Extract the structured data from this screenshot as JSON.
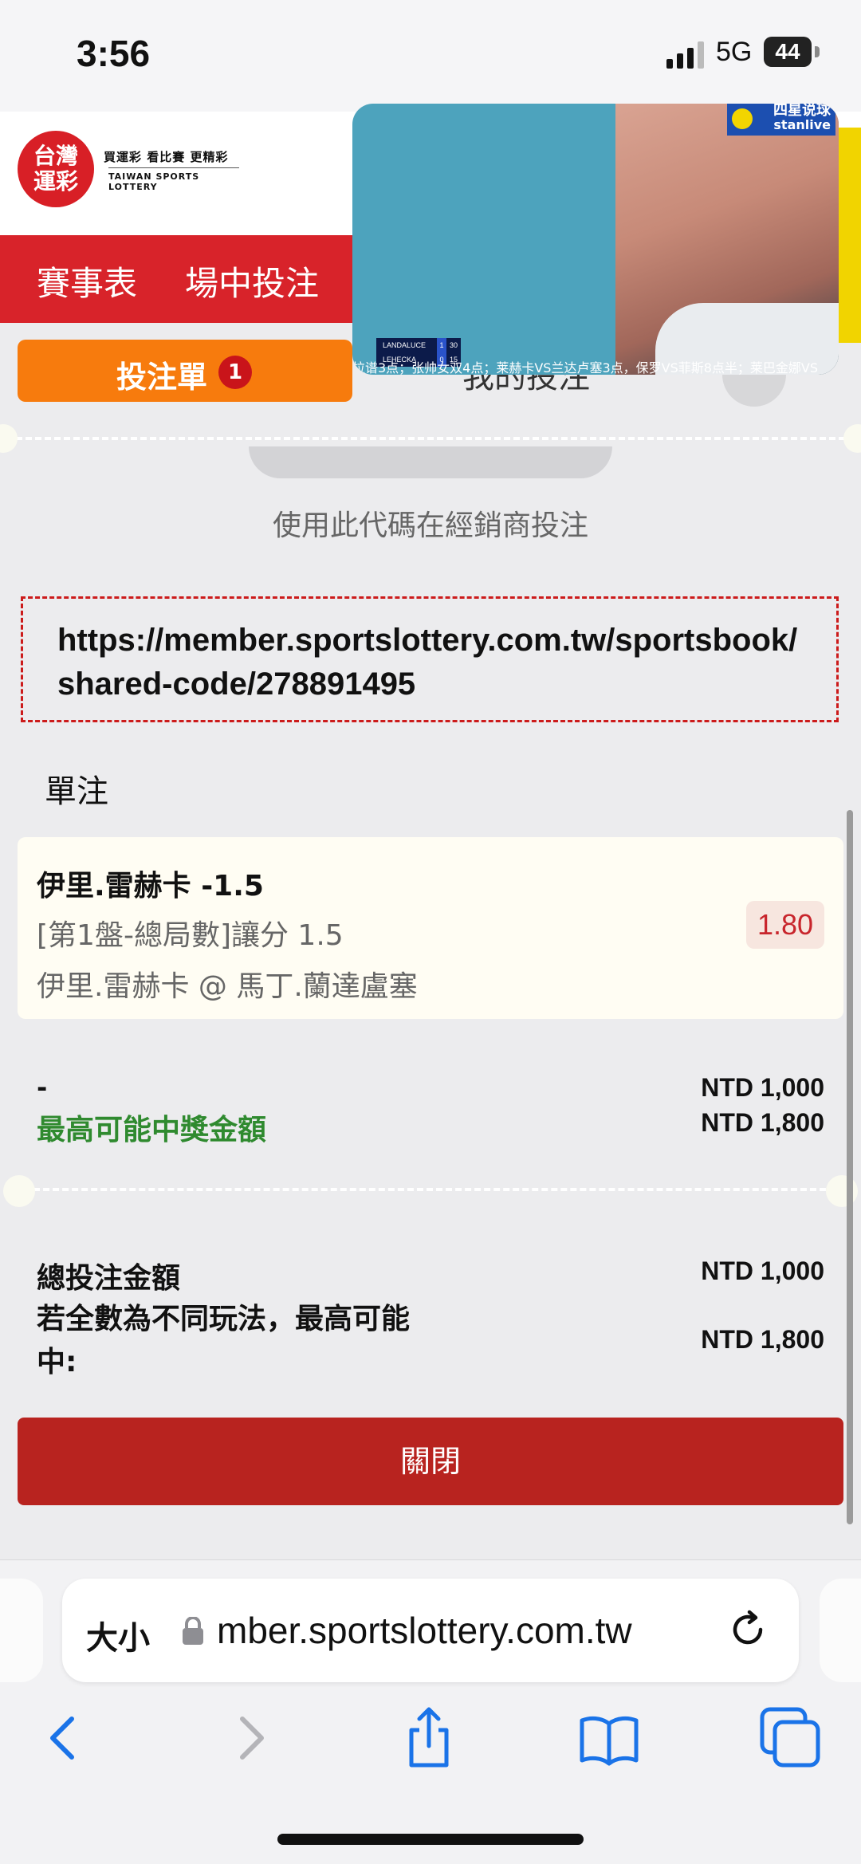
{
  "status_bar": {
    "time": "3:56",
    "network": "5G",
    "battery": "44"
  },
  "site": {
    "logo_text": "台灣運彩",
    "logo_line1": "台灣",
    "logo_line2": "運彩",
    "tagline": "買運彩 看比賽 更精彩",
    "tagline_en": "TAIWAN SPORTS LOTTERY"
  },
  "nav": {
    "items": [
      "賽事表",
      "場中投注"
    ]
  },
  "video": {
    "brand": "四星说球",
    "brand_sub": "stanlive",
    "score_rows": [
      {
        "name": "LANDALUCE",
        "sets": "1",
        "points": "30"
      },
      {
        "name": "LEHECKA",
        "sets": "0",
        "points": "15"
      }
    ],
    "ticker": "拉谱3点；张帅女双4点；莱赫卡VS兰达卢塞3点，保罗VS菲斯8点半；莱巴金娜VS"
  },
  "betslip": {
    "label": "投注單",
    "count": "1",
    "header_text": "我的投注"
  },
  "share": {
    "hint": "使用此代碼在經銷商投注",
    "url": "https://member.sportslottery.com.tw/sportsbook/shared-code/278891495"
  },
  "single": {
    "title": "單注",
    "bet": {
      "selection": "伊里.雷赫卡 -1.5",
      "market": "[第1盤-總局數]讓分 1.5",
      "match": "伊里.雷赫卡 @ 馬丁.蘭達盧塞",
      "odds": "1.80"
    },
    "stake_label": "-",
    "stake_amount": "NTD 1,000",
    "max_win_label": "最高可能中獎金額",
    "max_win_amount": "NTD 1,800"
  },
  "summary": {
    "total_label": "總投注金額",
    "total_amount": "NTD 1,000",
    "max_label": "若全數為不同玩法，最高可能中:",
    "max_amount": "NTD 1,800"
  },
  "close_label": "關閉",
  "browser": {
    "text_size": "大小",
    "address": "mber.sportslottery.com.tw"
  },
  "colors": {
    "brand_red": "#d8232a",
    "betslip_orange": "#f77b0d",
    "close_red": "#b8231f",
    "win_green": "#2f8a2f",
    "odds_red": "#c8252c",
    "ios_blue": "#1a73e8"
  }
}
